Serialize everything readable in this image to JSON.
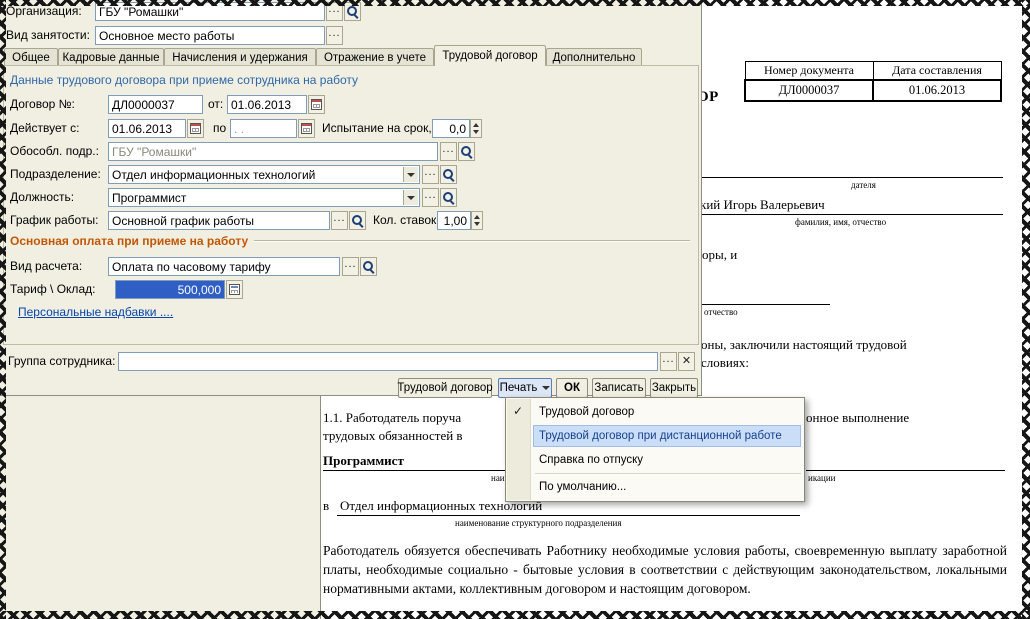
{
  "form": {
    "organization": {
      "label": "Организация:",
      "value": "ГБУ \"Ромашки\""
    },
    "employment": {
      "label": "Вид занятости:",
      "value": "Основное место работы"
    },
    "tabs": [
      {
        "label": "Общее"
      },
      {
        "label": "Кадровые данные"
      },
      {
        "label": "Начисления и удержания"
      },
      {
        "label": "Отражение в учете"
      },
      {
        "label": "Трудовой договор"
      },
      {
        "label": "Дополнительно"
      }
    ],
    "section_title": "Данные трудового договора при приеме сотрудника на работу",
    "contract_number": {
      "label": "Договор №:",
      "value": "ДЛ0000037"
    },
    "contract_date": {
      "label": "от:",
      "value": "01.06.2013"
    },
    "valid_from": {
      "label": "Действует с:",
      "value": "01.06.2013"
    },
    "valid_to": {
      "label": "по",
      "value": ".  ."
    },
    "probation": {
      "label": "Испытание на срок, мес.:",
      "value": "0,0"
    },
    "separate_division": {
      "label": "Обособл. подр.:",
      "value": "ГБУ \"Ромашки\""
    },
    "department": {
      "label": "Подразделение:",
      "value": "Отдел информационных технологий"
    },
    "position": {
      "label": "Должность:",
      "value": "Программист"
    },
    "schedule": {
      "label": "График работы:",
      "value": "Основной график работы"
    },
    "rate_count": {
      "label": "Кол. ставок:",
      "value": "1,00"
    },
    "pay_section_title": "Основная оплата при приеме на работу",
    "calc_type": {
      "label": "Вид расчета:",
      "value": "Оплата по часовому тарифу"
    },
    "salary": {
      "label": "Тариф \\ Оклад:",
      "value": "500,000"
    },
    "personal_bonuses_link": "Персональные надбавки ....",
    "employee_group": {
      "label": "Группа сотрудника:",
      "value": ""
    },
    "footer": {
      "contract_button": "Трудовой договор",
      "print_button": "Печать",
      "ok_button": "ОК",
      "save_button": "Записать",
      "close_button": "Закрыть"
    }
  },
  "print_menu": {
    "items": [
      {
        "label": "Трудовой договор",
        "checked": true
      },
      {
        "label": "Трудовой договор при дистанционной работе",
        "highlighted": true
      },
      {
        "label": "Справка по отпуску"
      },
      {
        "label": "По умолчанию..."
      }
    ]
  },
  "document": {
    "header_table": {
      "number_header": "Номер документа",
      "date_header": "Дата составления",
      "number_value": "ДЛ0000037",
      "date_value": "01.06.2013"
    },
    "title_fragment": "ОР",
    "employer_caption_fragment": "дателя",
    "name_fragment": "кий Игорь Валерьевич",
    "name_caption": "фамилия, имя, отчество",
    "fragment_1": "оры, и",
    "caption_fragment_2": "отчество",
    "fragment_3": "оны, заключили настоящий трудовой",
    "fragment_4": "словиях:",
    "clause_left_1": "1.1. Работодатель поруча",
    "clause_right_1": "онное выполнение",
    "clause_left_2": "трудовых обязанностей в",
    "position_value": "Программист",
    "position_caption_left": "наи",
    "position_caption_right": "икации",
    "department_prefix": "в",
    "department_value": "Отдел информационных технологий",
    "department_caption": "наименование структурного подразделения",
    "obligation_paragraph": "Работодатель обязуется обеспечивать Работнику необходимые условия работы, своевременную выплату заработной  платы, необходимые социально - бытовые условия в соответствии с действующим законодательством, локальными нормативными актами, коллективным договором и настоящим договором."
  },
  "icons": {
    "check": "✓",
    "dots": "...",
    "close": "✕"
  },
  "colors": {
    "form_background": "#F1EFE2",
    "section_heading": "#2E67A8",
    "pay_heading": "#C25703",
    "link": "#0645AD",
    "selection": "#2F5FC4",
    "menu_highlight": "#CBDEF7"
  }
}
